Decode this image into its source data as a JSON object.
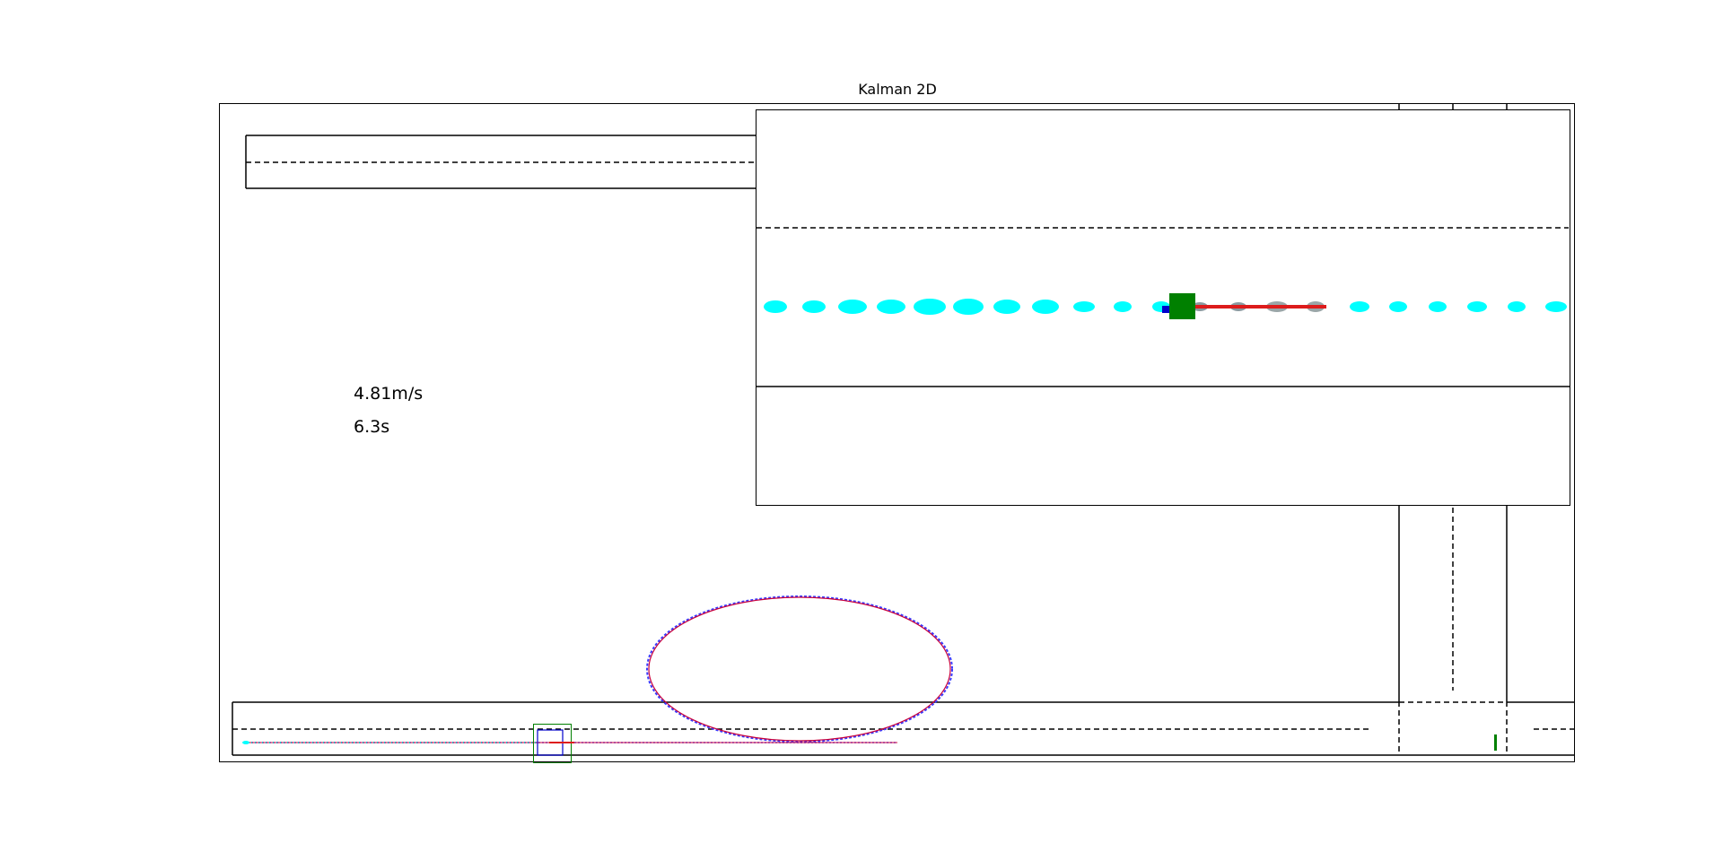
{
  "title": "Kalman 2D",
  "speed_text": "4.81m/s",
  "time_text": "6.3s",
  "colors": {
    "road": "#000000",
    "ellipse": "#00ffff",
    "car": "#008000",
    "track": "#dd1c1c",
    "estimate": "#0000cc",
    "path_truth": "#c8003c",
    "path_estimate": "#3a3aff"
  },
  "chart_data": {
    "type": "scatter",
    "title": "Kalman 2D",
    "xlabel": "",
    "ylabel": "",
    "grid": false,
    "legend": "none",
    "annotations": [
      "4.81m/s",
      "6.3s"
    ],
    "inset": "zoomed view of vehicle with covariance ellipses"
  }
}
